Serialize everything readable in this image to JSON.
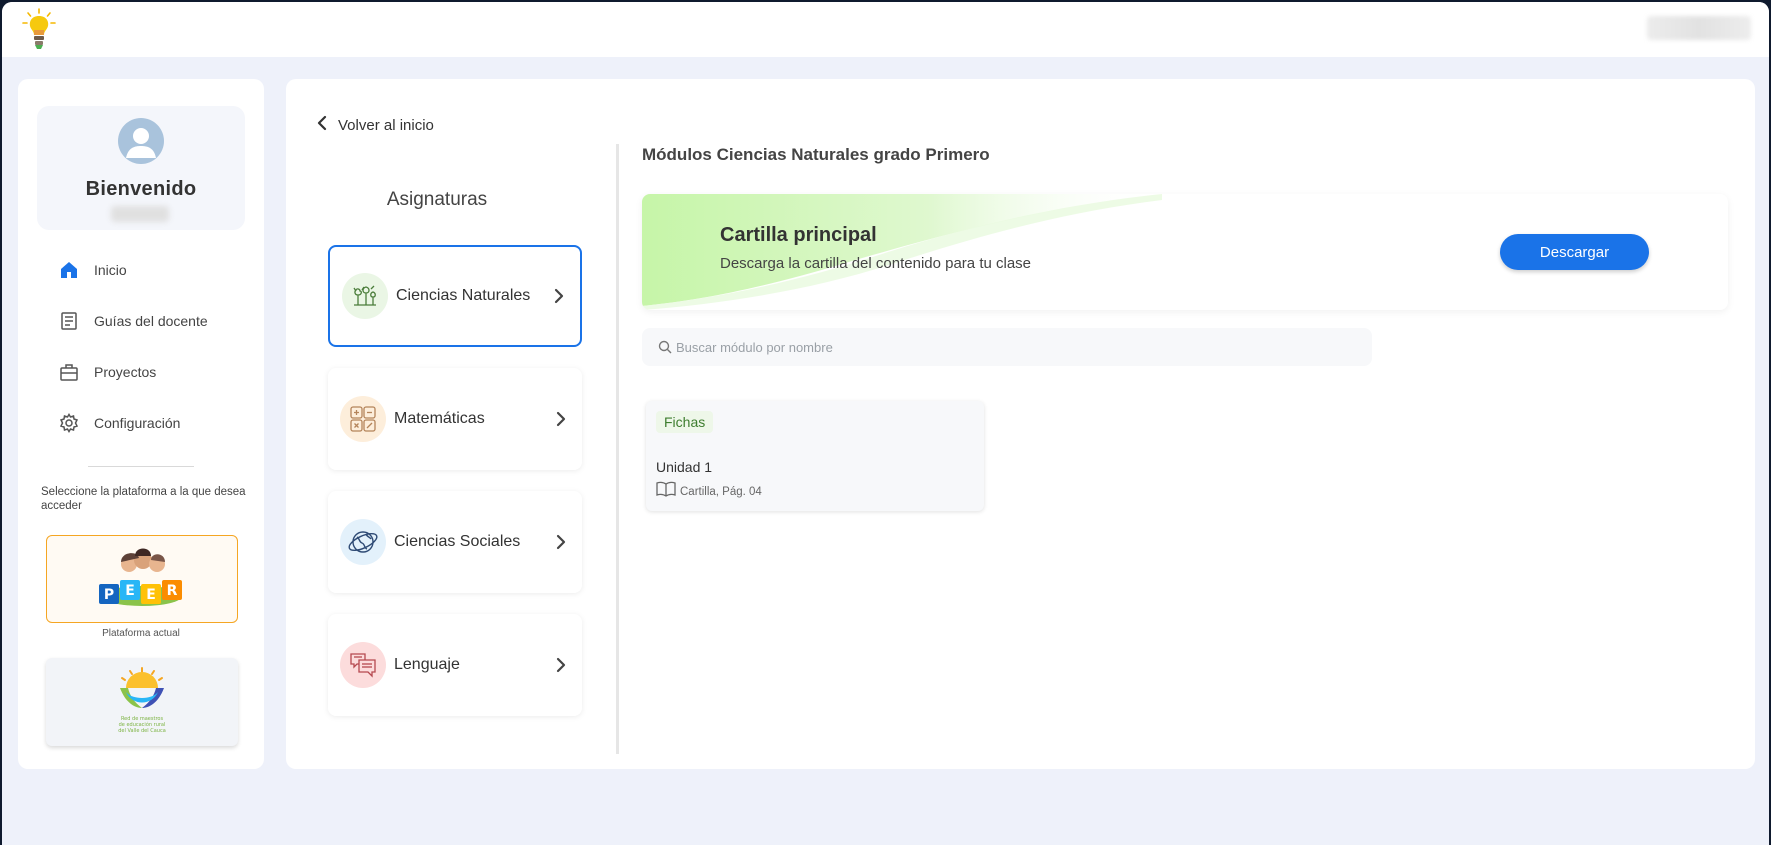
{
  "app": {
    "logo_icon": "lightbulb-logo-icon"
  },
  "sidebar": {
    "welcome": "Bienvenido",
    "nav": [
      {
        "label": "Inicio",
        "icon": "home-icon"
      },
      {
        "label": "Guías del docente",
        "icon": "document-icon"
      },
      {
        "label": "Proyectos",
        "icon": "briefcase-icon"
      },
      {
        "label": "Configuración",
        "icon": "gear-icon"
      }
    ],
    "platform_prompt": "Seleccione la plataforma a la que desea acceder",
    "current_platform_caption": "Plataforma actual",
    "platforms": [
      {
        "logo_text": "PEER"
      },
      {
        "logo_text": "Red de maestros de educación rural del Valle del Cauca"
      }
    ]
  },
  "main": {
    "back_label": "Volver al inicio",
    "subjects_title": "Asignaturas",
    "subjects": [
      {
        "label": "Ciencias Naturales",
        "icon": "plants-icon",
        "active": true
      },
      {
        "label": "Matemáticas",
        "icon": "calculator-icon",
        "active": false
      },
      {
        "label": "Ciencias Sociales",
        "icon": "globe-icon",
        "active": false
      },
      {
        "label": "Lenguaje",
        "icon": "chat-icon",
        "active": false
      }
    ],
    "modules_title": "Módulos Ciencias Naturales grado Primero",
    "banner": {
      "title": "Cartilla principal",
      "subtitle": "Descarga la cartilla del contenido para tu clase",
      "button": "Descargar"
    },
    "search_placeholder": "Buscar módulo por nombre",
    "modules": [
      {
        "tag": "Fichas",
        "unit": "Unidad 1",
        "ref": "Cartilla, Pág. 04"
      }
    ]
  },
  "colors": {
    "accent": "#1a73e8",
    "background": "#eef1fa",
    "active_border": "#1a73e8",
    "banner_green": "#c9f5b0"
  }
}
